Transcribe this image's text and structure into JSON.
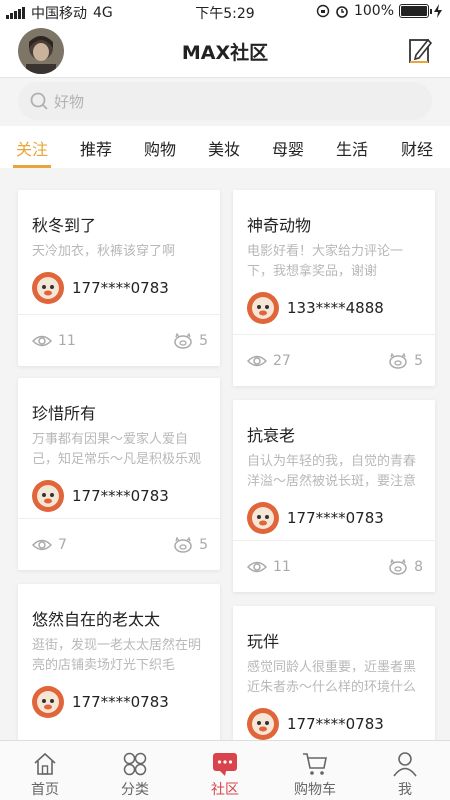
{
  "status_bar": {
    "carrier": "中国移动",
    "network": "4G",
    "time": "下午5:29",
    "battery": "100%",
    "battery_level": 1.0
  },
  "header": {
    "title": "MAX社区"
  },
  "search": {
    "placeholder": "好物"
  },
  "tabs": [
    {
      "label": "关注",
      "active": true
    },
    {
      "label": "推荐",
      "active": false
    },
    {
      "label": "购物",
      "active": false
    },
    {
      "label": "美妆",
      "active": false
    },
    {
      "label": "母婴",
      "active": false
    },
    {
      "label": "生活",
      "active": false
    },
    {
      "label": "财经",
      "active": false
    }
  ],
  "cards": [
    {
      "title": "秋冬到了",
      "desc": "天冷加衣，秋裤该穿了啊",
      "user": "177****0783",
      "views": "11",
      "likes": "5"
    },
    {
      "title": "神奇动物",
      "desc": "电影好看！大家给力评论一下，我想拿奖品，谢谢",
      "user": "133****4888",
      "views": "27",
      "likes": "5"
    },
    {
      "title": "珍惜所有",
      "desc": "万事都有因果～爱家人爱自己，知足常乐～凡是积极乐观",
      "user": "177****0783",
      "views": "7",
      "likes": "5"
    },
    {
      "title": "抗衰老",
      "desc": "自认为年轻的我，自觉的青春洋溢～居然被说长斑，要注意",
      "user": "177****0783",
      "views": "11",
      "likes": "8"
    },
    {
      "title": "悠然自在的老太太",
      "desc": "逛街，发现一老太太居然在明亮的店铺卖场灯光下织毛",
      "user": "177****0783",
      "views": "",
      "likes": ""
    },
    {
      "title": "玩伴",
      "desc": "感觉同龄人很重要，近墨者黑近朱者赤～什么样的环境什么",
      "user": "177****0783",
      "views": "",
      "likes": ""
    }
  ],
  "nav": [
    {
      "label": "首页",
      "icon": "home-icon"
    },
    {
      "label": "分类",
      "icon": "grid-icon"
    },
    {
      "label": "社区",
      "icon": "chat-icon",
      "active": true
    },
    {
      "label": "购物车",
      "icon": "cart-icon"
    },
    {
      "label": "我",
      "icon": "user-icon"
    }
  ],
  "colors": {
    "accent": "#e8a53a",
    "nav_active": "#d9444c",
    "user_avatar": "#e0653a"
  }
}
